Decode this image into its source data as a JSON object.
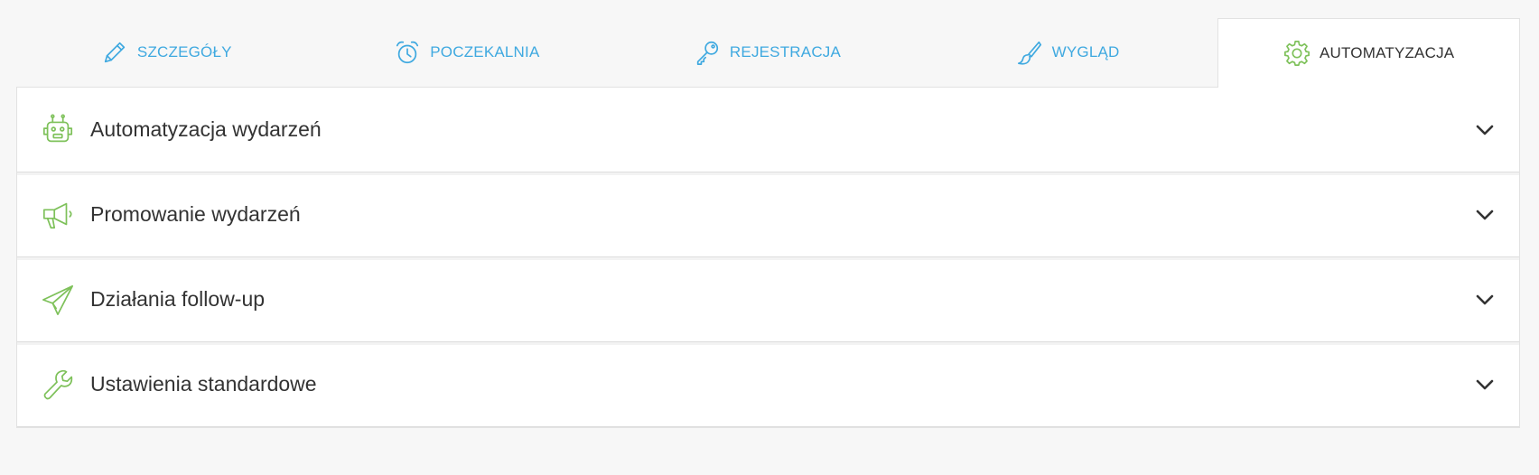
{
  "colors": {
    "tab_link": "#3fa9e0",
    "tab_active_text": "#333333",
    "accent_icon": "#7ec15a",
    "page_background": "#f7f7f7"
  },
  "tabs": [
    {
      "label": "SZCZEGÓŁY",
      "icon": "pencil-icon",
      "active": false
    },
    {
      "label": "POCZEKALNIA",
      "icon": "alarm-clock-icon",
      "active": false
    },
    {
      "label": "REJESTRACJA",
      "icon": "key-icon",
      "active": false
    },
    {
      "label": "WYGLĄD",
      "icon": "paint-brush-icon",
      "active": false
    },
    {
      "label": "AUTOMATYZACJA",
      "icon": "gear-icon",
      "active": true
    }
  ],
  "sections": [
    {
      "label": "Automatyzacja wydarzeń",
      "icon": "robot-icon",
      "expanded": false
    },
    {
      "label": "Promowanie wydarzeń",
      "icon": "megaphone-icon",
      "expanded": false
    },
    {
      "label": "Działania follow-up",
      "icon": "paper-plane-icon",
      "expanded": false
    },
    {
      "label": "Ustawienia standardowe",
      "icon": "wrench-icon",
      "expanded": false
    }
  ]
}
